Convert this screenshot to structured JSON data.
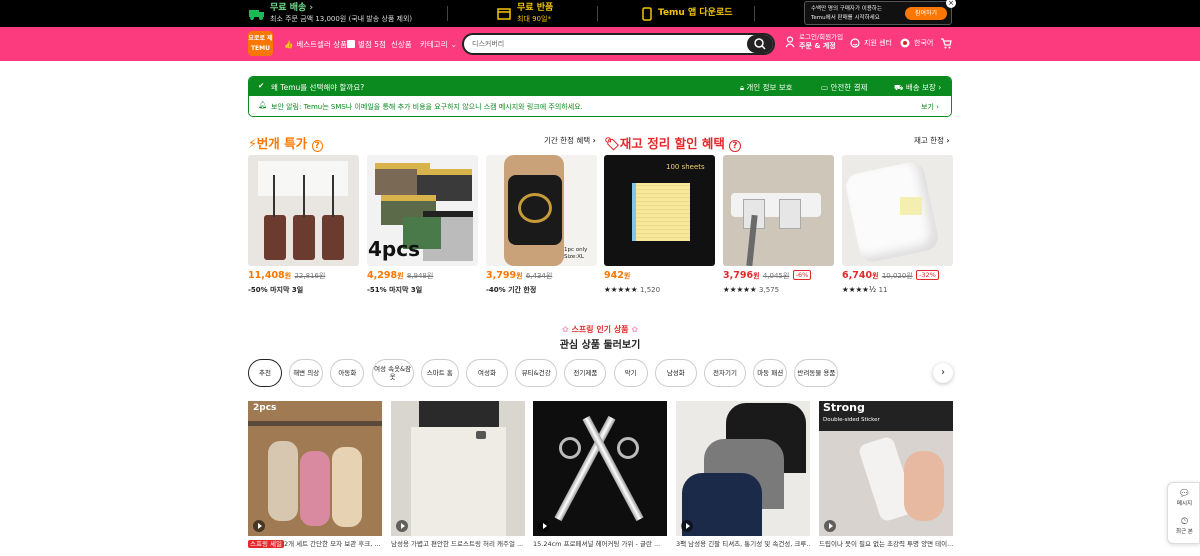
{
  "topbar": {
    "shipping_title": "무료 배송",
    "shipping_sub": "최소 주문 금액 13,000원 (국내 발송 상품 제외)",
    "returns_title": "무료 반품",
    "returns_sub": "최대 90일*",
    "app_title": "Temu 앱 다운로드",
    "promo_text1": "수백만 명의 구매자가 이용하는",
    "promo_text2": "Temu에서 판매를 시작하세요",
    "promo_btn": "참여하기"
  },
  "header": {
    "logo_line1": "요로로 제",
    "logo_line2": "TEMU",
    "nav": [
      "베스트셀러 상품",
      "별점 5점",
      "신상품",
      "카테고리"
    ],
    "search_placeholder": "디스커버리",
    "account_line1": "로그인/회원가입",
    "account_line2": "주문 & 계정",
    "support": "지원 센터",
    "language": "한국어"
  },
  "notice": {
    "why": "왜 Temu를 선택해야 할까요?",
    "privacy": "개인 정보 보호",
    "payment": "안전한 결제",
    "delivery": "배송 보장",
    "alert": "보안 알림: Temu는 SMS나 이메일을 통해 추가 비용을 요구하지 않으니 스캠 메시지와 링크에 주의하세요.",
    "view": "보기"
  },
  "lightning": {
    "title": "번개 특가",
    "link": "기간 한정 혜택",
    "items": [
      {
        "price": "11,408",
        "unit": "원",
        "orig": "22,816원",
        "sub": "-50% 마지막 3일"
      },
      {
        "price": "4,298",
        "unit": "원",
        "orig": "8,948원",
        "sub": "-51% 마지막 3일",
        "overlay": "4pcs"
      },
      {
        "price": "3,799",
        "unit": "원",
        "orig": "6,434원",
        "sub": "-40% 기간 한정",
        "overlay": "1pc only Size:XL"
      }
    ]
  },
  "clearance": {
    "title": "재고 정리 할인 혜택",
    "link": "재고 한정",
    "items": [
      {
        "price": "942",
        "unit": "원",
        "rating": "★★★★★",
        "count": "1,520",
        "overlay": "100 sheets"
      },
      {
        "price": "3,796",
        "unit": "원",
        "orig": "4,045원",
        "disc": "-6%",
        "rating": "★★★★★",
        "count": "3,575"
      },
      {
        "price": "6,740",
        "unit": "원",
        "orig": "10,020원",
        "disc": "-32%",
        "rating": "★★★★½",
        "count": "11"
      }
    ]
  },
  "spring": {
    "badge": "스프링 인기 상품",
    "title": "관심 상품 둘러보기"
  },
  "categories": [
    "추천",
    "해변 의상",
    "아동화",
    "여성 속옷&잠옷",
    "스마트 홈",
    "여성화",
    "뷰티&건강",
    "전기제품",
    "악기",
    "남성화",
    "전자기기",
    "마둥 패션",
    "반려동물 용품"
  ],
  "grid": [
    {
      "title": "2개 세트 간단한 모자 보관 후크, ...",
      "tag": "스프링 세일",
      "overlay": "2pcs"
    },
    {
      "title": "남성용 가볍고 편안한 드로스트링 허리 캐주얼 ..."
    },
    {
      "title": "15.24cm 프로페셔널 헤어커팅 가위 - 글란 ..."
    },
    {
      "title": "3팩 남성용 긴팔 티셔츠, 통기성 및 속건성, 크루..."
    },
    {
      "title": "드립이나 못이 필요 없는 초강력 투명 양면 테이...",
      "overlay": "Strong",
      "overlay2": "Double-sided Sticker"
    }
  ],
  "side": {
    "messages": "메시지",
    "recent": "최근 본"
  },
  "colors": {
    "brand_pink": "#fb3b7e",
    "orange": "#fb7701",
    "green": "#0a8a1f",
    "red": "#e4292b"
  }
}
